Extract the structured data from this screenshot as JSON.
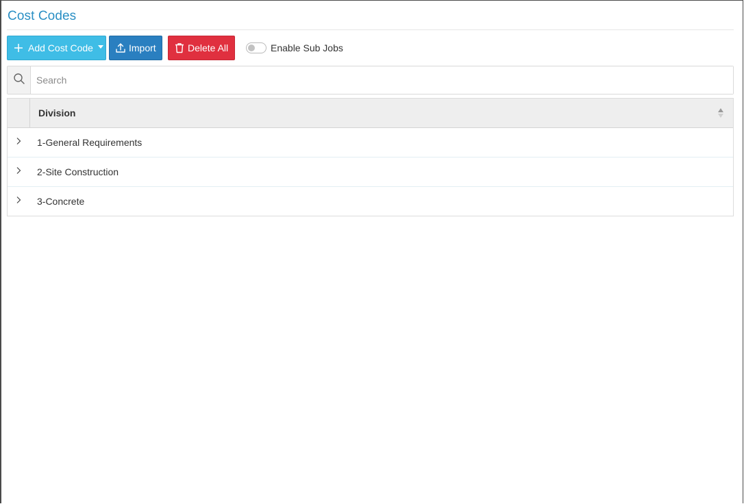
{
  "page": {
    "title": "Cost Codes"
  },
  "toolbar": {
    "add_label": "Add Cost Code",
    "import_label": "Import",
    "delete_label": "Delete All",
    "toggle_label": "Enable Sub Jobs",
    "toggle_on": false
  },
  "search": {
    "placeholder": "Search",
    "value": ""
  },
  "grid": {
    "column_header": "Division",
    "rows": [
      {
        "label": "1-General Requirements",
        "expanded": false
      },
      {
        "label": "2-Site Construction",
        "expanded": false
      },
      {
        "label": "3-Concrete",
        "expanded": false
      }
    ]
  },
  "icons": {
    "add": "plus-icon",
    "import": "upload-icon",
    "delete": "trash-icon",
    "search": "search-icon",
    "row_expand": "chevron-right-icon",
    "sort": "sort-icon"
  },
  "colors": {
    "title": "#2a8fc4",
    "add_button": "#3fbde6",
    "import_button": "#2a7fc0",
    "delete_button": "#e0303f",
    "header_bg": "#eeeeee"
  }
}
